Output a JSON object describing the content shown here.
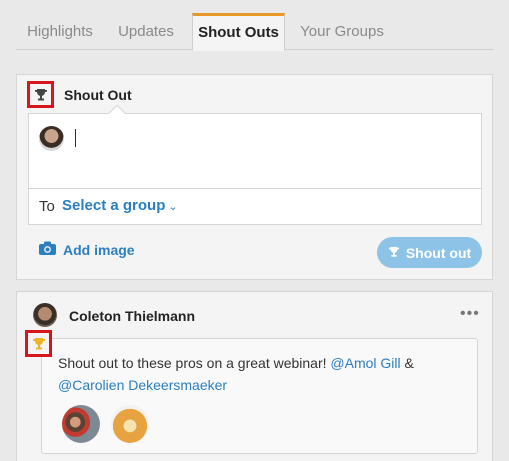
{
  "tabs": [
    "Highlights",
    "Updates",
    "Shout Outs",
    "Your Groups"
  ],
  "active_tab": "Shout Outs",
  "composer": {
    "title": "Shout Out",
    "to_label": "To",
    "select_group": "Select a group",
    "add_image": "Add image",
    "shout_button": "Shout out",
    "accent_color": "#2a7fc1",
    "button_color": "#8cc3e6"
  },
  "post": {
    "author": "Coleton Thielmann",
    "text_before": "Shout out to these pros on a great webinar! ",
    "mention1": "@Amol Gill",
    "connector": " & ",
    "mention2": "@Carolien Dekeersmaeker",
    "more": "•••"
  },
  "icons": [
    "trophy-icon",
    "camera-icon",
    "chevron-down-icon",
    "more-icon"
  ]
}
